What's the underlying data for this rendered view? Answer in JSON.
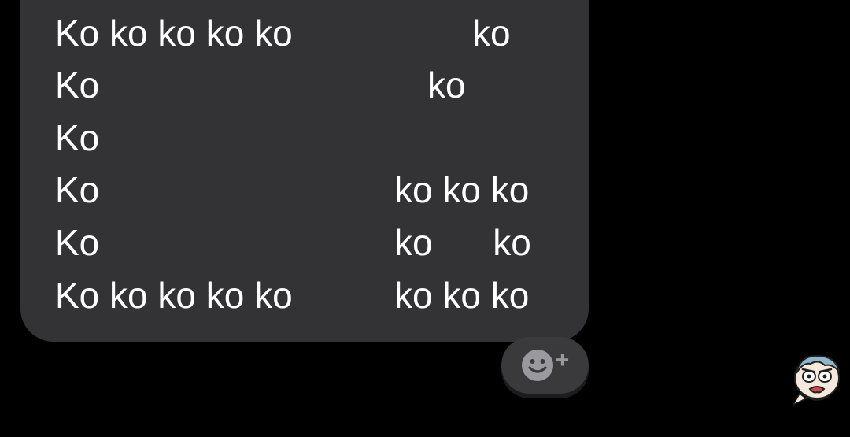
{
  "message": {
    "lines": [
      {
        "left": "Ko ko ko ko ko",
        "right": "ko"
      },
      {
        "left": "Ko",
        "right": "ko"
      },
      {
        "left": "Ko",
        "right": ""
      },
      {
        "left": "Ko",
        "right": "ko ko ko"
      },
      {
        "left": "Ko",
        "right": "ko      ko"
      },
      {
        "left": "Ko ko ko ko ko",
        "right": "ko ko ko"
      }
    ]
  },
  "reaction": {
    "icon": "smiley-face-icon",
    "plus_label": "+"
  },
  "avatar": {
    "icon": "cartoon-face-sticker-avatar"
  },
  "colors": {
    "background": "#000000",
    "bubble": "#333235",
    "text": "#ffffff",
    "reaction_bg": "#3a3a3d",
    "reaction_icon": "#9a9a9e"
  }
}
